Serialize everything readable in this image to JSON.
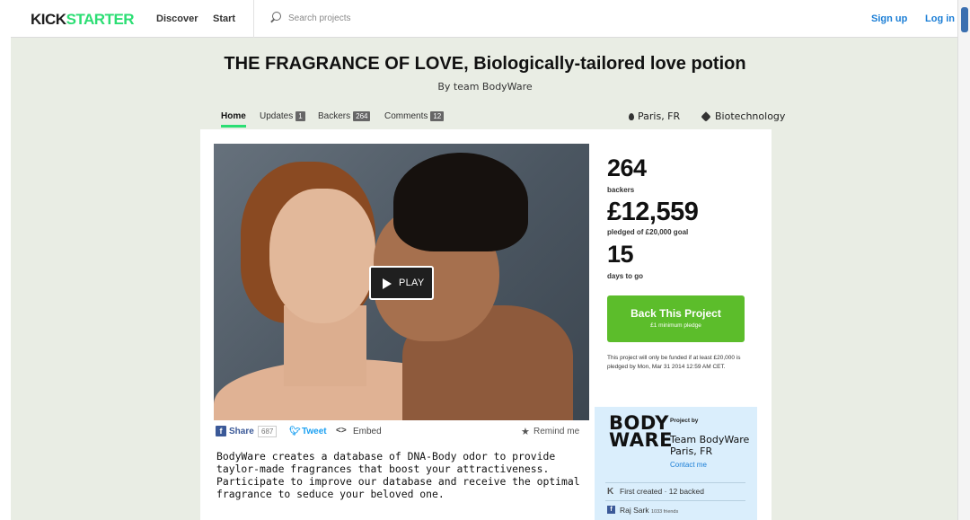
{
  "nav": {
    "logo_part1": "KICK",
    "logo_part2": "STARTER",
    "discover": "Discover",
    "start": "Start",
    "search_placeholder": "Search projects",
    "signup": "Sign up",
    "login": "Log in"
  },
  "project": {
    "title": "THE FRAGRANCE OF LOVE, Biologically-tailored love potion",
    "byline": "By team BodyWare",
    "location": "Paris, FR",
    "category": "Biotechnology"
  },
  "tabs": [
    {
      "label": "Home",
      "count": ""
    },
    {
      "label": "Updates",
      "count": "1"
    },
    {
      "label": "Backers",
      "count": "264"
    },
    {
      "label": "Comments",
      "count": "12"
    }
  ],
  "video": {
    "play_label": "PLAY"
  },
  "share": {
    "share_label": "Share",
    "share_count": "687",
    "tweet_label": "Tweet",
    "embed_label": "Embed",
    "remind_label": "Remind me"
  },
  "blurb": "BodyWare creates a database of DNA-Body odor to provide taylor-made fragrances that boost your attractiveness. Participate to improve our database and receive the optimal fragrance to seduce your beloved one.",
  "stats": {
    "backers_value": "264",
    "backers_label": "backers",
    "pledged_value": "£12,559",
    "pledged_label": "pledged of £20,000 goal",
    "days_value": "15",
    "days_label": "days to go"
  },
  "back_button": {
    "title": "Back This Project",
    "sub": "£1 minimum pledge"
  },
  "funding_note": "This project will only be funded if at least £20,000 is pledged by Mon, Mar 31 2014 12:59 AM CET.",
  "creator": {
    "logo_line1": "BODY",
    "logo_line2": "WARE",
    "project_by": "Project by",
    "name": "Team BodyWare",
    "location": "Paris, FR",
    "contact": "Contact me",
    "created": "First created · 12 backed",
    "friend_name": "Raj Sark",
    "friend_count": "1033 friends"
  },
  "colors": {
    "brand_green": "#2bde73",
    "back_button": "#5cbd2b",
    "link_blue": "#1b7ed6",
    "page_bg": "#e9ede4"
  }
}
